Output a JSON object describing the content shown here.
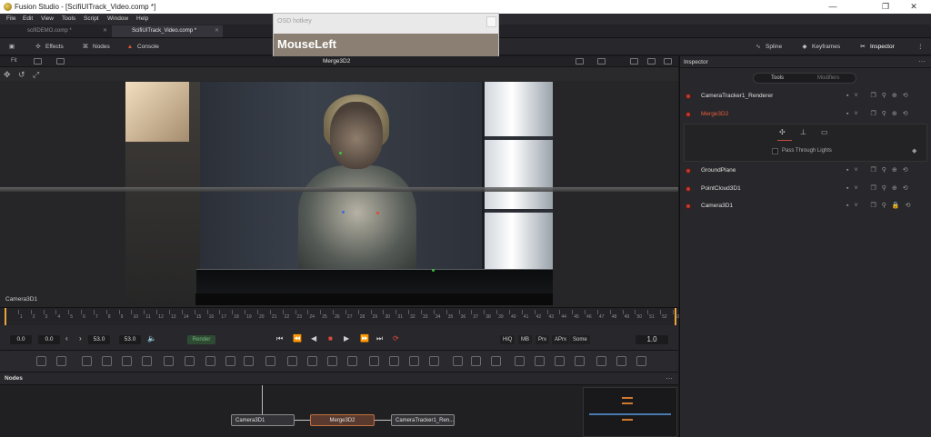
{
  "window": {
    "title": "Fusion Studio - [ScifiUITrack_Video.comp *]",
    "minimize": "—",
    "maximize": "❐",
    "close": "✕"
  },
  "menu": [
    "File",
    "Edit",
    "View",
    "Tools",
    "Script",
    "Window",
    "Help"
  ],
  "comp_tabs": [
    {
      "label": "scifiDEMO.comp *",
      "active": false
    },
    {
      "label": "ScifiUITrack_Video.comp *",
      "active": true
    }
  ],
  "toolbar": {
    "effects": "Effects",
    "nodes": "Nodes",
    "console": "Console",
    "spline": "Spline",
    "keyframes": "Keyframes",
    "inspector": "Inspector"
  },
  "osd": {
    "label": "OSD hotkey",
    "value": "MouseLeft"
  },
  "viewer": {
    "fit": "Fit",
    "node_name": "Merge3D2",
    "camera_label": "Camera3D1"
  },
  "ruler": {
    "ticks": [
      "0",
      "1",
      "2",
      "3",
      "4",
      "5",
      "6",
      "7",
      "8",
      "9",
      "10",
      "11",
      "12",
      "13",
      "14",
      "15",
      "16",
      "17",
      "18",
      "19",
      "20",
      "21",
      "22",
      "23",
      "24",
      "25",
      "26",
      "27",
      "28",
      "29",
      "30",
      "31",
      "32",
      "33",
      "34",
      "35",
      "36",
      "37",
      "38",
      "39",
      "40",
      "41",
      "42",
      "43",
      "44",
      "45",
      "46",
      "47",
      "48",
      "49",
      "50",
      "51",
      "52",
      "53"
    ]
  },
  "transport": {
    "start": "0.0",
    "current": "0.0",
    "end_render": "53.0",
    "end": "53.0",
    "render": "Render",
    "hiq": "HiQ",
    "mb": "MB",
    "prx": "Prx",
    "aprx": "APrx",
    "some": "Some",
    "step": "1.0"
  },
  "nodes_panel": {
    "title": "Nodes",
    "nodes": [
      "Camera3D1",
      "Merge3D2",
      "CameraTracker1_Ren..."
    ]
  },
  "inspector": {
    "title": "Inspector",
    "tabs": {
      "tools": "Tools",
      "modifiers": "Modifiers"
    },
    "rows": [
      {
        "name": "CameraTracker1_Renderer",
        "highlight": false
      },
      {
        "name": "Merge3D2",
        "highlight": true
      },
      {
        "name": "GroundPlane",
        "highlight": false
      },
      {
        "name": "PointCloud3D1",
        "highlight": false
      },
      {
        "name": "Camera3D1",
        "highlight": false
      }
    ],
    "pass_through": "Pass Through Lights"
  },
  "colors": {
    "accent_orange": "#e8a33a",
    "node_active": "#c2703e",
    "tool_dot": "#c03a2c",
    "render_green": "#77b77e"
  }
}
